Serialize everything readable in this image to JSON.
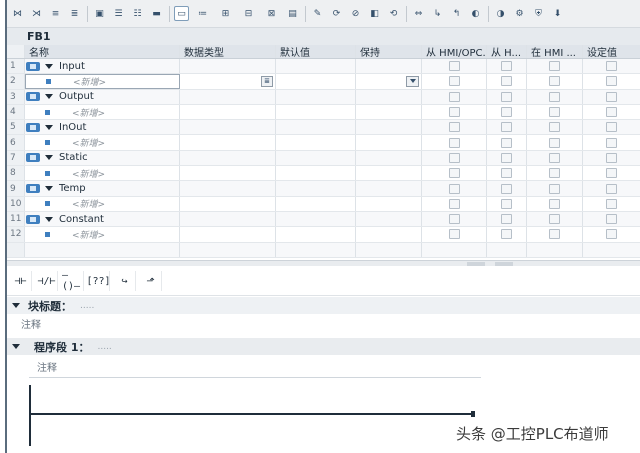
{
  "block": {
    "name": "FB1"
  },
  "toolbar": {
    "icons": [
      "add-network-icon",
      "delete-network-icon",
      "insert-row-icon",
      "add-row-icon",
      "rename-icon",
      "expand-all-icon",
      "collapse-all-icon",
      "bookmark-icon",
      "comment-icon",
      "absolute-operand-icon",
      "symbol-icon",
      "symbol-info-icon",
      "symbol-list-icon",
      "network-comment-icon",
      "favorites-icon",
      "go-online-icon",
      "go-offline-icon",
      "monitor-icon",
      "refresh-icon",
      "compare-icon",
      "next-bookmark-icon",
      "prev-bookmark-icon",
      "first-error-icon",
      "next-error-icon",
      "settings-icon",
      "protect-icon",
      "download-icon"
    ]
  },
  "interface_table": {
    "headers": {
      "name": "名称",
      "data_type": "数据类型",
      "default_value": "默认值",
      "retain": "保持",
      "from_hmi_opc": "从 HMI/OPC...",
      "from_h": "从 H...",
      "in_hmi": "在 HMI ...",
      "setpoint": "设定值"
    },
    "rows": [
      {
        "num": "1",
        "kind": "section",
        "label": "Input"
      },
      {
        "num": "2",
        "kind": "new",
        "label": "<新增>",
        "editing": true
      },
      {
        "num": "3",
        "kind": "section",
        "label": "Output"
      },
      {
        "num": "4",
        "kind": "new",
        "label": "<新增>"
      },
      {
        "num": "5",
        "kind": "section",
        "label": "InOut"
      },
      {
        "num": "6",
        "kind": "new",
        "label": "<新增>"
      },
      {
        "num": "7",
        "kind": "section",
        "label": "Static"
      },
      {
        "num": "8",
        "kind": "new",
        "label": "<新增>"
      },
      {
        "num": "9",
        "kind": "section",
        "label": "Temp"
      },
      {
        "num": "10",
        "kind": "new",
        "label": "<新增>"
      },
      {
        "num": "11",
        "kind": "section",
        "label": "Constant"
      },
      {
        "num": "12",
        "kind": "new",
        "label": "<新增>"
      },
      {
        "num": "",
        "kind": "empty",
        "label": ""
      }
    ]
  },
  "lad_toolbar": {
    "items": [
      {
        "icon": "no-contact-icon",
        "glyph": "⊣⊢"
      },
      {
        "icon": "nc-contact-icon",
        "glyph": "⊣/⊢"
      },
      {
        "icon": "coil-icon",
        "glyph": "–()–"
      },
      {
        "icon": "empty-box-icon",
        "glyph": "[??]"
      },
      {
        "icon": "open-branch-icon",
        "glyph": "↪"
      },
      {
        "icon": "close-branch-icon",
        "glyph": "⬏"
      }
    ]
  },
  "block_title": {
    "label": "块标题：",
    "dots": ".....",
    "comment": "注释"
  },
  "network": {
    "label": "程序段 1：",
    "dots": ".....",
    "comment": "注释"
  },
  "watermark": "头条 @工控PLC布道师"
}
